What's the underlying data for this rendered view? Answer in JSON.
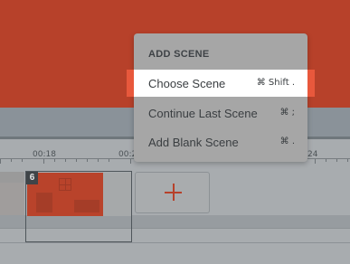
{
  "timeline": {
    "ruler_labels": [
      "00:18",
      "00:2",
      "24"
    ],
    "selected_scene_number": "6"
  },
  "menu": {
    "header": "ADD SCENE",
    "items": [
      {
        "label": "Choose Scene",
        "shortcut": "⌘ Shift .",
        "highlighted": true
      },
      {
        "label": "Continue Last Scene",
        "shortcut": "⌘ ;",
        "highlighted": false
      },
      {
        "label": "Add Blank Scene",
        "shortcut": "⌘ .",
        "highlighted": false
      }
    ]
  },
  "icons": {
    "add": "plus-icon"
  },
  "colors": {
    "accent": "#b7412a",
    "highlight_edge": "#e8583c"
  }
}
